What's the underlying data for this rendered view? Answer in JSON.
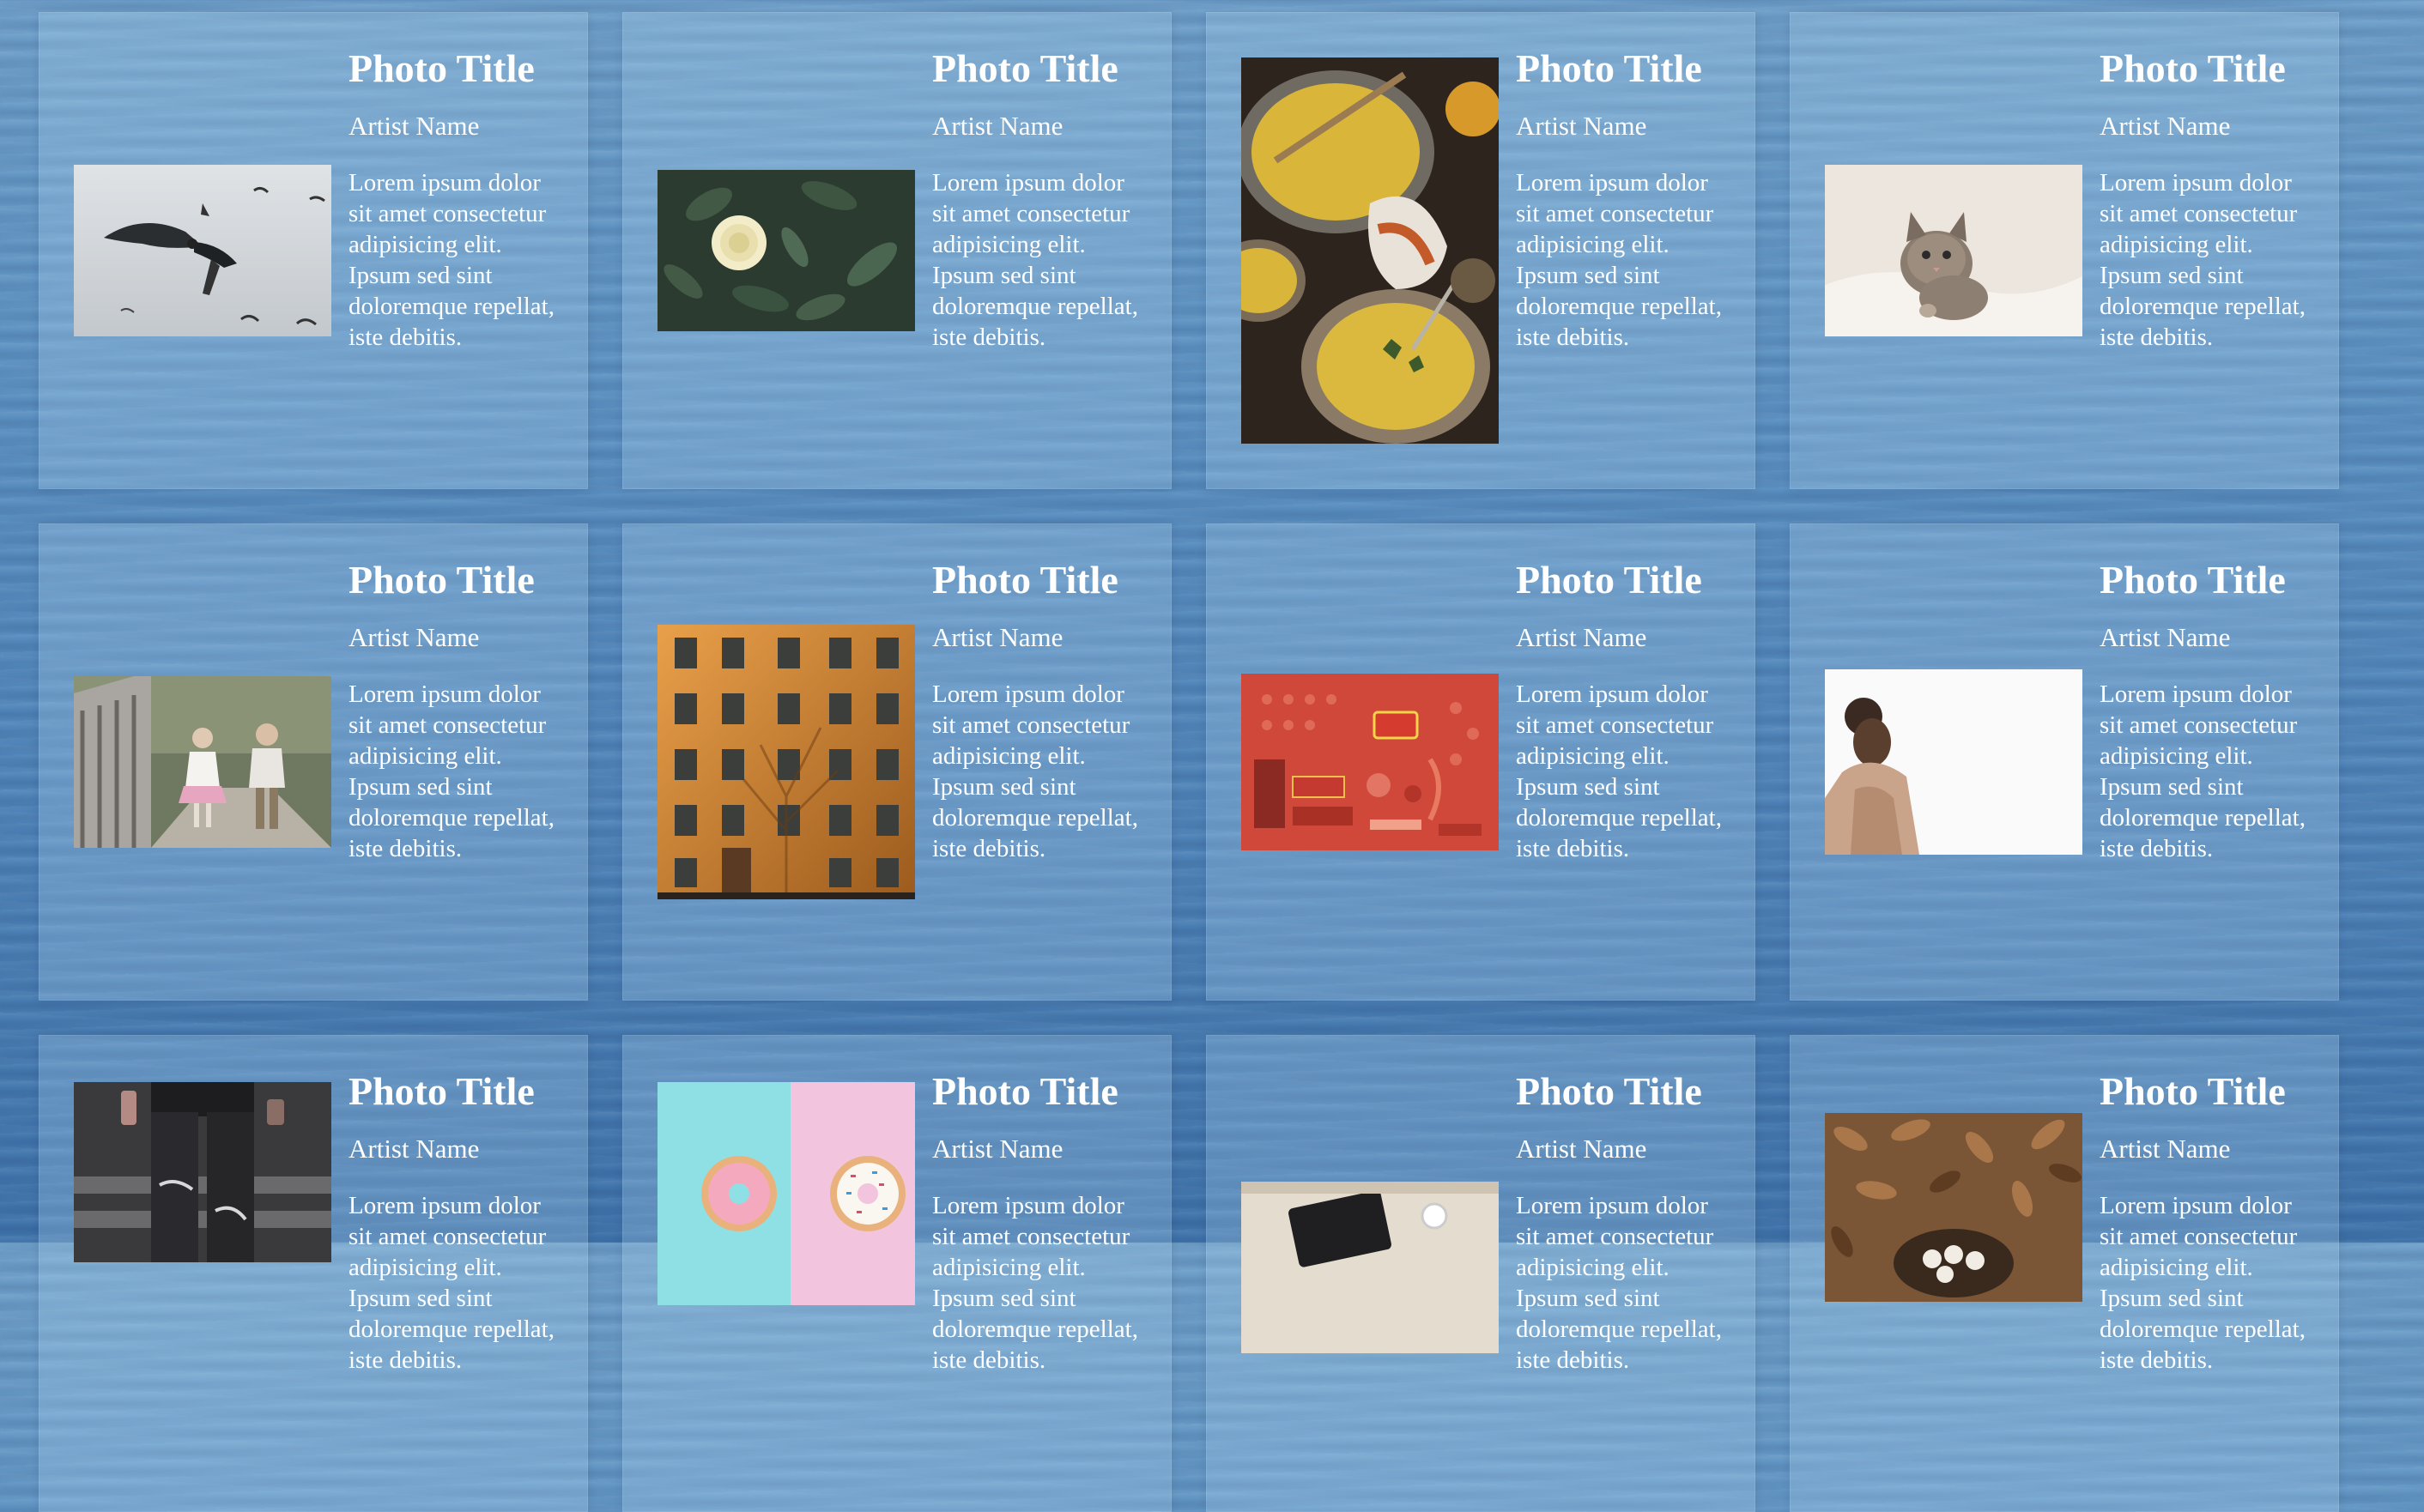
{
  "cards": [
    {
      "title": "Photo Title",
      "artist": "Artist Name",
      "description": "Lorem ipsum dolor sit amet consectetur adipisicing elit. Ipsum sed sint doloremque repellat, iste debitis."
    },
    {
      "title": "Photo Title",
      "artist": "Artist Name",
      "description": "Lorem ipsum dolor sit amet consectetur adipisicing elit. Ipsum sed sint doloremque repellat, iste debitis."
    },
    {
      "title": "Photo Title",
      "artist": "Artist Name",
      "description": "Lorem ipsum dolor sit amet consectetur adipisicing elit. Ipsum sed sint doloremque repellat, iste debitis."
    },
    {
      "title": "Photo Title",
      "artist": "Artist Name",
      "description": "Lorem ipsum dolor sit amet consectetur adipisicing elit. Ipsum sed sint doloremque repellat, iste debitis."
    },
    {
      "title": "Photo Title",
      "artist": "Artist Name",
      "description": "Lorem ipsum dolor sit amet consectetur adipisicing elit. Ipsum sed sint doloremque repellat, iste debitis."
    },
    {
      "title": "Photo Title",
      "artist": "Artist Name",
      "description": "Lorem ipsum dolor sit amet consectetur adipisicing elit. Ipsum sed sint doloremque repellat, iste debitis."
    },
    {
      "title": "Photo Title",
      "artist": "Artist Name",
      "description": "Lorem ipsum dolor sit amet consectetur adipisicing elit. Ipsum sed sint doloremque repellat, iste debitis."
    },
    {
      "title": "Photo Title",
      "artist": "Artist Name",
      "description": "Lorem ipsum dolor sit amet consectetur adipisicing elit. Ipsum sed sint doloremque repellat, iste debitis."
    },
    {
      "title": "Photo Title",
      "artist": "Artist Name",
      "description": "Lorem ipsum dolor sit amet consectetur adipisicing elit. Ipsum sed sint doloremque repellat, iste debitis."
    },
    {
      "title": "Photo Title",
      "artist": "Artist Name",
      "description": "Lorem ipsum dolor sit amet consectetur adipisicing elit. Ipsum sed sint doloremque repellat, iste debitis."
    },
    {
      "title": "Photo Title",
      "artist": "Artist Name",
      "description": "Lorem ipsum dolor sit amet consectetur adipisicing elit. Ipsum sed sint doloremque repellat, iste debitis."
    },
    {
      "title": "Photo Title",
      "artist": "Artist Name",
      "description": "Lorem ipsum dolor sit amet consectetur adipisicing elit. Ipsum sed sint doloremque repellat, iste debitis."
    }
  ],
  "images": [
    {
      "icon": "bird-photo-icon"
    },
    {
      "icon": "rose-photo-icon"
    },
    {
      "icon": "soup-photo-icon"
    },
    {
      "icon": "kitten-photo-icon"
    },
    {
      "icon": "children-walking-photo-icon"
    },
    {
      "icon": "building-photo-icon"
    },
    {
      "icon": "candy-flatlay-photo-icon"
    },
    {
      "icon": "girl-portrait-photo-icon"
    },
    {
      "icon": "jeans-photo-icon"
    },
    {
      "icon": "donuts-photo-icon"
    },
    {
      "icon": "laptop-desk-photo-icon"
    },
    {
      "icon": "autumn-leaves-photo-icon"
    }
  ],
  "colors": {
    "text": "#ffffff",
    "background": "#5a8fc0",
    "card": "rgba(180,215,240,0.28)"
  }
}
